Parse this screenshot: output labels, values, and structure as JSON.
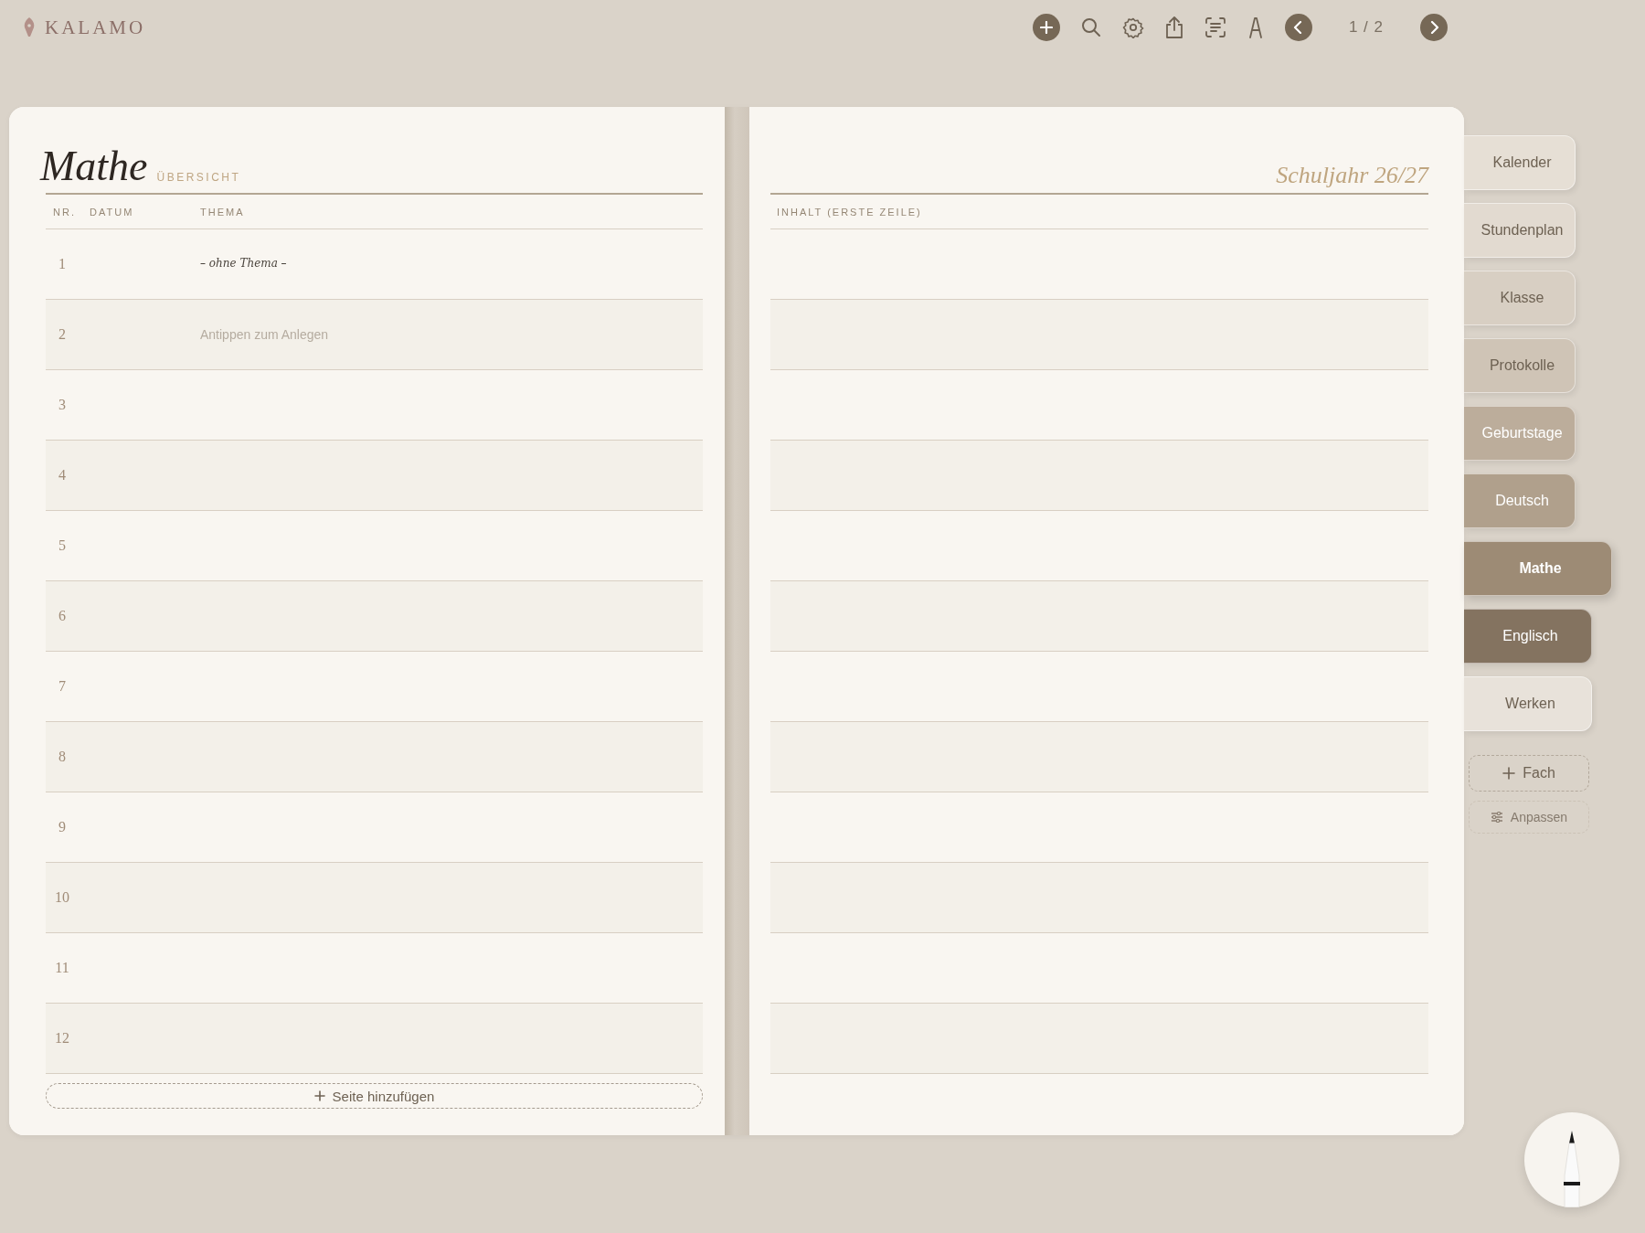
{
  "app": {
    "name": "KALAMO"
  },
  "toolbar": {
    "page_indicator": "1 / 2"
  },
  "left_page": {
    "title": "Mathe",
    "subtitle": "ÜBERSICHT",
    "columns": [
      "NR.",
      "DATUM",
      "THEMA"
    ],
    "rows": [
      {
        "nr": "1",
        "topic": "– ohne Thema –",
        "kind": "handwriting"
      },
      {
        "nr": "2",
        "topic": "Antippen zum Anlegen",
        "kind": "placeholder"
      },
      {
        "nr": "3"
      },
      {
        "nr": "4"
      },
      {
        "nr": "5"
      },
      {
        "nr": "6"
      },
      {
        "nr": "7"
      },
      {
        "nr": "8"
      },
      {
        "nr": "9"
      },
      {
        "nr": "10"
      },
      {
        "nr": "11"
      },
      {
        "nr": "12"
      }
    ],
    "add_button": "Seite hinzufügen"
  },
  "right_page": {
    "title": "Schuljahr 26/27",
    "column": "INHALT (ERSTE ZEILE)"
  },
  "tabs": [
    {
      "label": "Kalender",
      "color": "#e6dfd5",
      "selected": false
    },
    {
      "label": "Stundenplan",
      "color": "#e2dad0",
      "selected": false
    },
    {
      "label": "Klasse",
      "color": "#d8cfc3",
      "selected": false
    },
    {
      "label": "Protokolle",
      "color": "#cfc4b6",
      "selected": false
    },
    {
      "label": "Geburtstage",
      "color": "#bcad9b",
      "selected": false
    },
    {
      "label": "Deutsch",
      "color": "#b0a08c",
      "selected": false
    },
    {
      "label": "Mathe",
      "color": "#9d8b75",
      "selected": true
    },
    {
      "label": "Englisch",
      "color": "#847360",
      "selected": false
    },
    {
      "label": "Werken",
      "color": "#e8e2da",
      "selected": false
    }
  ],
  "tab_actions": [
    "Fach",
    "Anpassen"
  ]
}
